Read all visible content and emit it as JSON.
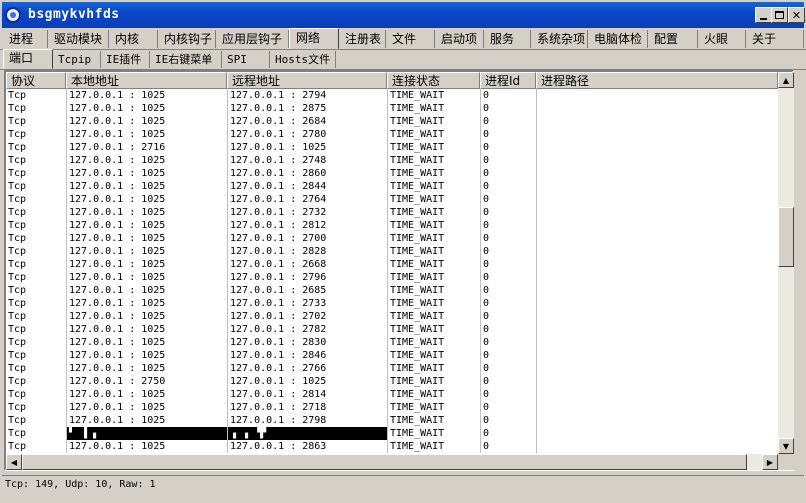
{
  "window": {
    "title": "bsgmykvhfds"
  },
  "main_tabs": [
    "进程",
    "驱动模块",
    "内核",
    "内核钩子",
    "应用层钩子",
    "网络",
    "注册表",
    "文件",
    "启动项",
    "服务",
    "系统杂项",
    "电脑体检",
    "配置",
    "火眼",
    "关于"
  ],
  "main_tab_active": "网络",
  "sub_tabs": [
    "端口",
    "Tcpip",
    "IE插件",
    "IE右键菜单",
    "SPI",
    "Hosts文件"
  ],
  "sub_tab_active": "端口",
  "columns": [
    "协议",
    "本地地址",
    "远程地址",
    "连接状态",
    "进程Id",
    "进程路径"
  ],
  "rows": [
    {
      "proto": "Tcp",
      "local": "127.0.0.1 : 1025",
      "remote": "127.0.0.1 : 2794",
      "state": "TIME_WAIT",
      "pid": "0",
      "path": ""
    },
    {
      "proto": "Tcp",
      "local": "127.0.0.1 : 1025",
      "remote": "127.0.0.1 : 2875",
      "state": "TIME_WAIT",
      "pid": "0",
      "path": ""
    },
    {
      "proto": "Tcp",
      "local": "127.0.0.1 : 1025",
      "remote": "127.0.0.1 : 2684",
      "state": "TIME_WAIT",
      "pid": "0",
      "path": ""
    },
    {
      "proto": "Tcp",
      "local": "127.0.0.1 : 1025",
      "remote": "127.0.0.1 : 2780",
      "state": "TIME_WAIT",
      "pid": "0",
      "path": ""
    },
    {
      "proto": "Tcp",
      "local": "127.0.0.1 : 2716",
      "remote": "127.0.0.1 : 1025",
      "state": "TIME_WAIT",
      "pid": "0",
      "path": ""
    },
    {
      "proto": "Tcp",
      "local": "127.0.0.1 : 1025",
      "remote": "127.0.0.1 : 2748",
      "state": "TIME_WAIT",
      "pid": "0",
      "path": ""
    },
    {
      "proto": "Tcp",
      "local": "127.0.0.1 : 1025",
      "remote": "127.0.0.1 : 2860",
      "state": "TIME_WAIT",
      "pid": "0",
      "path": ""
    },
    {
      "proto": "Tcp",
      "local": "127.0.0.1 : 1025",
      "remote": "127.0.0.1 : 2844",
      "state": "TIME_WAIT",
      "pid": "0",
      "path": ""
    },
    {
      "proto": "Tcp",
      "local": "127.0.0.1 : 1025",
      "remote": "127.0.0.1 : 2764",
      "state": "TIME_WAIT",
      "pid": "0",
      "path": ""
    },
    {
      "proto": "Tcp",
      "local": "127.0.0.1 : 1025",
      "remote": "127.0.0.1 : 2732",
      "state": "TIME_WAIT",
      "pid": "0",
      "path": ""
    },
    {
      "proto": "Tcp",
      "local": "127.0.0.1 : 1025",
      "remote": "127.0.0.1 : 2812",
      "state": "TIME_WAIT",
      "pid": "0",
      "path": ""
    },
    {
      "proto": "Tcp",
      "local": "127.0.0.1 : 1025",
      "remote": "127.0.0.1 : 2700",
      "state": "TIME_WAIT",
      "pid": "0",
      "path": ""
    },
    {
      "proto": "Tcp",
      "local": "127.0.0.1 : 1025",
      "remote": "127.0.0.1 : 2828",
      "state": "TIME_WAIT",
      "pid": "0",
      "path": ""
    },
    {
      "proto": "Tcp",
      "local": "127.0.0.1 : 1025",
      "remote": "127.0.0.1 : 2668",
      "state": "TIME_WAIT",
      "pid": "0",
      "path": ""
    },
    {
      "proto": "Tcp",
      "local": "127.0.0.1 : 1025",
      "remote": "127.0.0.1 : 2796",
      "state": "TIME_WAIT",
      "pid": "0",
      "path": ""
    },
    {
      "proto": "Tcp",
      "local": "127.0.0.1 : 1025",
      "remote": "127.0.0.1 : 2685",
      "state": "TIME_WAIT",
      "pid": "0",
      "path": ""
    },
    {
      "proto": "Tcp",
      "local": "127.0.0.1 : 1025",
      "remote": "127.0.0.1 : 2733",
      "state": "TIME_WAIT",
      "pid": "0",
      "path": ""
    },
    {
      "proto": "Tcp",
      "local": "127.0.0.1 : 1025",
      "remote": "127.0.0.1 : 2702",
      "state": "TIME_WAIT",
      "pid": "0",
      "path": ""
    },
    {
      "proto": "Tcp",
      "local": "127.0.0.1 : 1025",
      "remote": "127.0.0.1 : 2782",
      "state": "TIME_WAIT",
      "pid": "0",
      "path": ""
    },
    {
      "proto": "Tcp",
      "local": "127.0.0.1 : 1025",
      "remote": "127.0.0.1 : 2830",
      "state": "TIME_WAIT",
      "pid": "0",
      "path": ""
    },
    {
      "proto": "Tcp",
      "local": "127.0.0.1 : 1025",
      "remote": "127.0.0.1 : 2846",
      "state": "TIME_WAIT",
      "pid": "0",
      "path": ""
    },
    {
      "proto": "Tcp",
      "local": "127.0.0.1 : 1025",
      "remote": "127.0.0.1 : 2766",
      "state": "TIME_WAIT",
      "pid": "0",
      "path": ""
    },
    {
      "proto": "Tcp",
      "local": "127.0.0.1 : 2750",
      "remote": "127.0.0.1 : 1025",
      "state": "TIME_WAIT",
      "pid": "0",
      "path": ""
    },
    {
      "proto": "Tcp",
      "local": "127.0.0.1 : 1025",
      "remote": "127.0.0.1 : 2814",
      "state": "TIME_WAIT",
      "pid": "0",
      "path": ""
    },
    {
      "proto": "Tcp",
      "local": "127.0.0.1 : 1025",
      "remote": "127.0.0.1 : 2718",
      "state": "TIME_WAIT",
      "pid": "0",
      "path": ""
    },
    {
      "proto": "Tcp",
      "local": "127.0.0.1 : 1025",
      "remote": "127.0.0.1 : 2798",
      "state": "TIME_WAIT",
      "pid": "0",
      "path": ""
    },
    {
      "proto": "Tcp",
      "local": "▘ ▐ ▖",
      "remote": "▗ ▗ ▝▛",
      "state": "TIME_WAIT",
      "pid": "0",
      "path": "",
      "corrupt": true
    },
    {
      "proto": "Tcp",
      "local": "127.0.0.1 : 1025",
      "remote": "127.0.0.1 : 2863",
      "state": "TIME_WAIT",
      "pid": "0",
      "path": ""
    }
  ],
  "status": {
    "text": "Tcp: 149, Udp: 10, Raw: 1"
  },
  "icons": {
    "app": "shield-globe-icon",
    "minimize": "minimize-icon",
    "maximize": "maximize-icon",
    "close": "close-icon"
  }
}
